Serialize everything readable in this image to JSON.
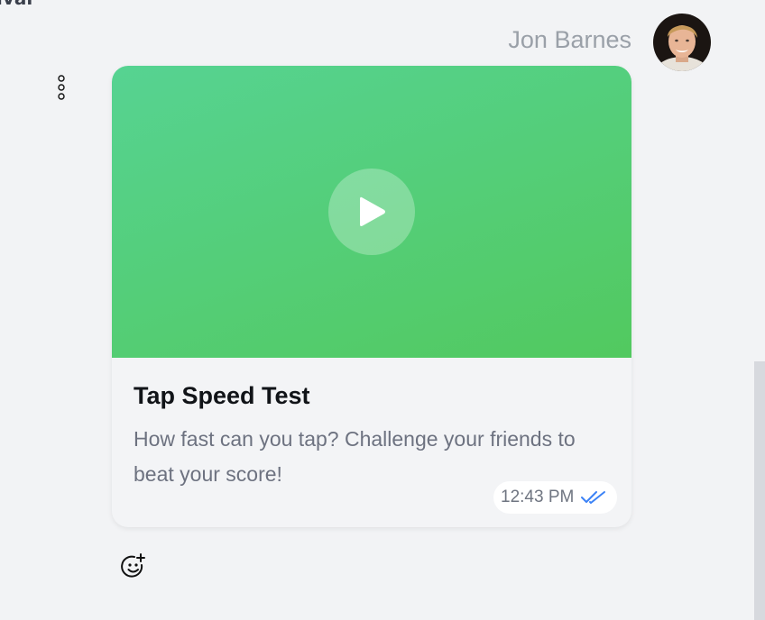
{
  "header": {
    "clipped_text": "ival",
    "sender_name": "Jon Barnes"
  },
  "icons": {
    "avatar": "user-avatar",
    "more": "more-vertical-icon",
    "play": "play-icon",
    "read_receipt": "double-check-icon",
    "reaction": "add-reaction-icon"
  },
  "message": {
    "card": {
      "title": "Tap Speed Test",
      "description": "How fast can you tap? Challenge your friends to beat your score!",
      "time": "12:43 PM",
      "status": "read"
    }
  },
  "colors": {
    "media_gradient_start": "#56d392",
    "media_gradient_end": "#52c95f",
    "read_receipt": "#3b82f6",
    "background": "#f2f3f5"
  }
}
